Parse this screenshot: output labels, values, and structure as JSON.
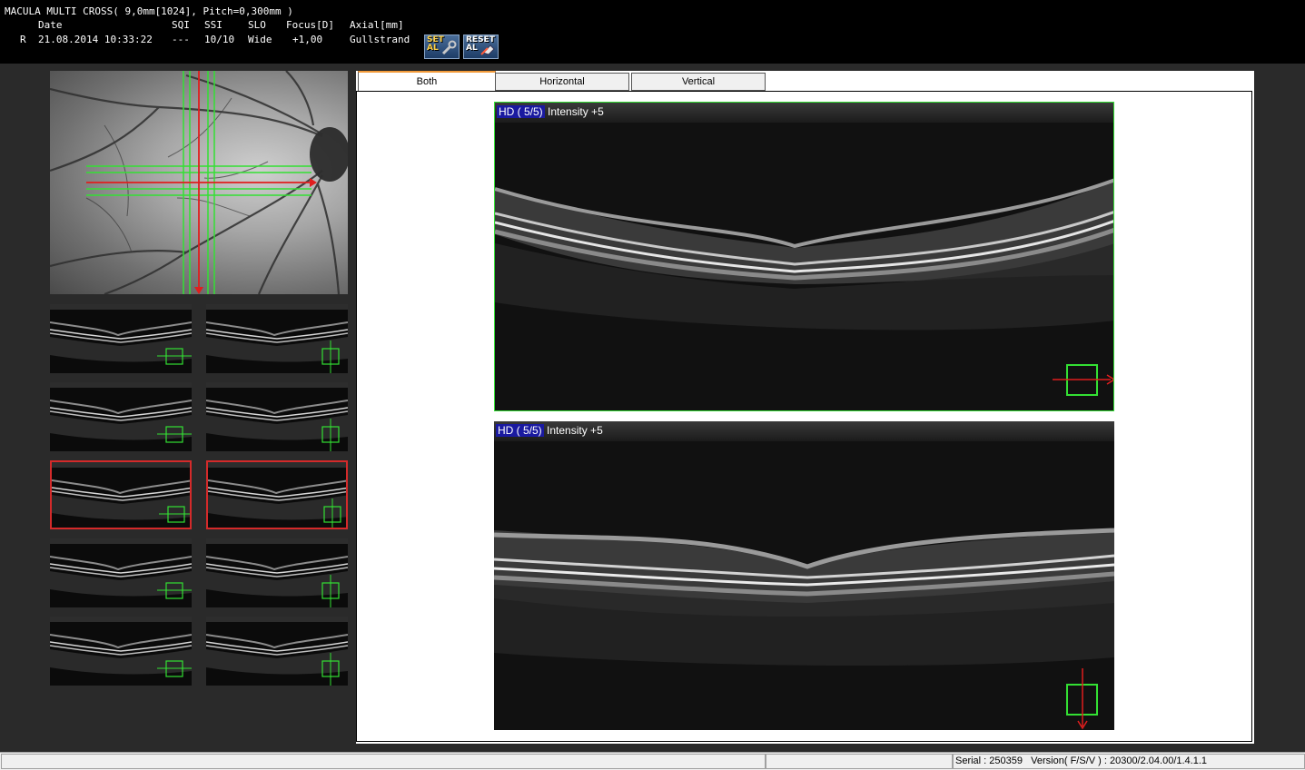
{
  "header": {
    "scan_title": "MACULA MULTI CROSS( 9,0mm[1024], Pitch=0,300mm )",
    "columns": {
      "date": "Date",
      "sqi": "SQI",
      "ssi": "SSI",
      "slo": "SLO",
      "focus": "Focus[D]",
      "axial": "Axial[mm]"
    },
    "values": {
      "eye": "R",
      "date": "21.08.2014 10:33:22",
      "sqi": "---",
      "ssi": "10/10",
      "slo": "Wide",
      "focus": "+1,00",
      "axial": "Gullstrand"
    },
    "buttons": {
      "set_al": [
        "SET",
        "AL"
      ],
      "reset_al": [
        "RESET",
        "AL"
      ]
    }
  },
  "tabs": [
    {
      "label": "Both",
      "active": true
    },
    {
      "label": "Horizontal",
      "active": false
    },
    {
      "label": "Vertical",
      "active": false
    }
  ],
  "bscans": {
    "top": {
      "quality": "HD ( 5/5)",
      "intensity": "Intensity +5",
      "orientation": "horizontal"
    },
    "bottom": {
      "quality": "HD ( 5/5)",
      "intensity": "Intensity +5",
      "orientation": "vertical"
    }
  },
  "thumbnails": {
    "count": 10,
    "selected": [
      4,
      5
    ]
  },
  "status": {
    "serial_text": "Serial : 250359   Version( F/S/V ) : 20300/2.04.00/1.4.1.1"
  },
  "colors": {
    "scan_line_green": "#33e033",
    "selected_line_red": "#e01e1e",
    "active_tab_accent": "#f29a3a",
    "hd_badge": "#1a1aa0"
  }
}
